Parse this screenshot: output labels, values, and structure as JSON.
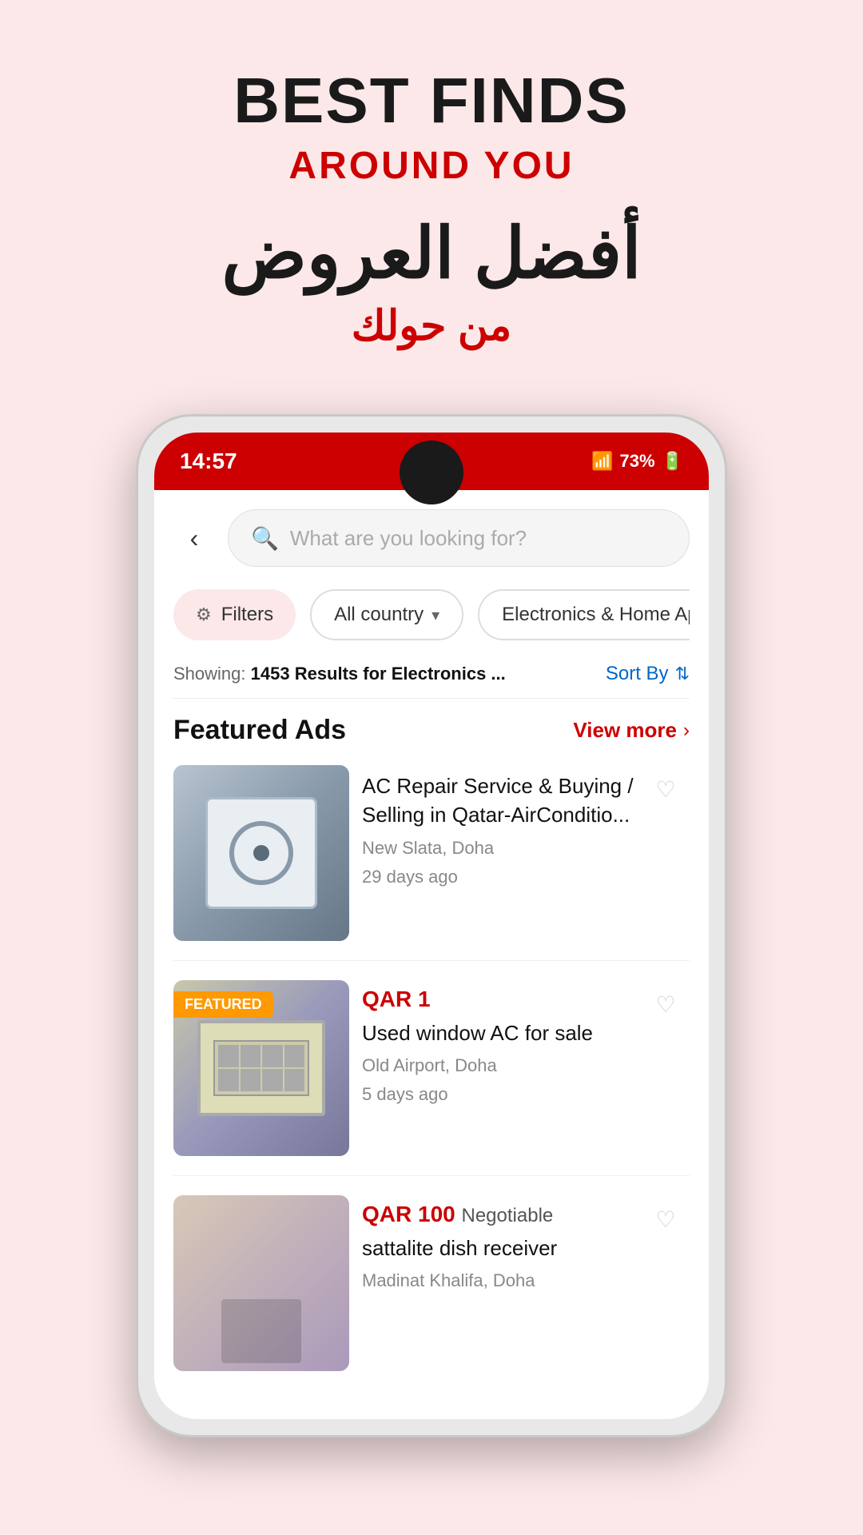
{
  "hero": {
    "best_finds": "BEST FINDS",
    "around_you": "AROUND YOU",
    "arabic_main": "أفضل العروض",
    "arabic_sub": "من حولك"
  },
  "status_bar": {
    "time": "14:57",
    "battery": "73%",
    "wifi_icon": "wifi",
    "signal_icon": "signal",
    "battery_icon": "battery"
  },
  "search": {
    "placeholder": "What are you looking for?",
    "back_label": "back"
  },
  "filters": {
    "filter_label": "Filters",
    "country_label": "All country",
    "category_label": "Electronics & Home Applia..."
  },
  "results": {
    "showing_text": "Showing:",
    "count_text": "1453 Results for Electronics ...",
    "sort_label": "Sort By"
  },
  "featured_ads": {
    "section_title": "Featured Ads",
    "view_more_label": "View more"
  },
  "listings": [
    {
      "id": 1,
      "price": null,
      "title": "AC Repair Service & Buying / Selling in Qatar-AirConditio...",
      "location": "New Slata, Doha",
      "time": "29 days ago",
      "featured": false
    },
    {
      "id": 2,
      "price": "QAR 1",
      "negotiable": null,
      "title": "Used window AC for sale",
      "location": "Old Airport, Doha",
      "time": "5 days ago",
      "featured": true,
      "featured_label": "FEATURED"
    },
    {
      "id": 3,
      "price": "QAR 100",
      "negotiable": "Negotiable",
      "title": "sattalite dish receiver",
      "location": "Madinat Khalifa, Doha",
      "time": "",
      "featured": false
    }
  ],
  "colors": {
    "primary_red": "#cc0000",
    "status_bar_red": "#cc0000",
    "featured_orange": "#ff9900",
    "sort_blue": "#0066cc"
  }
}
